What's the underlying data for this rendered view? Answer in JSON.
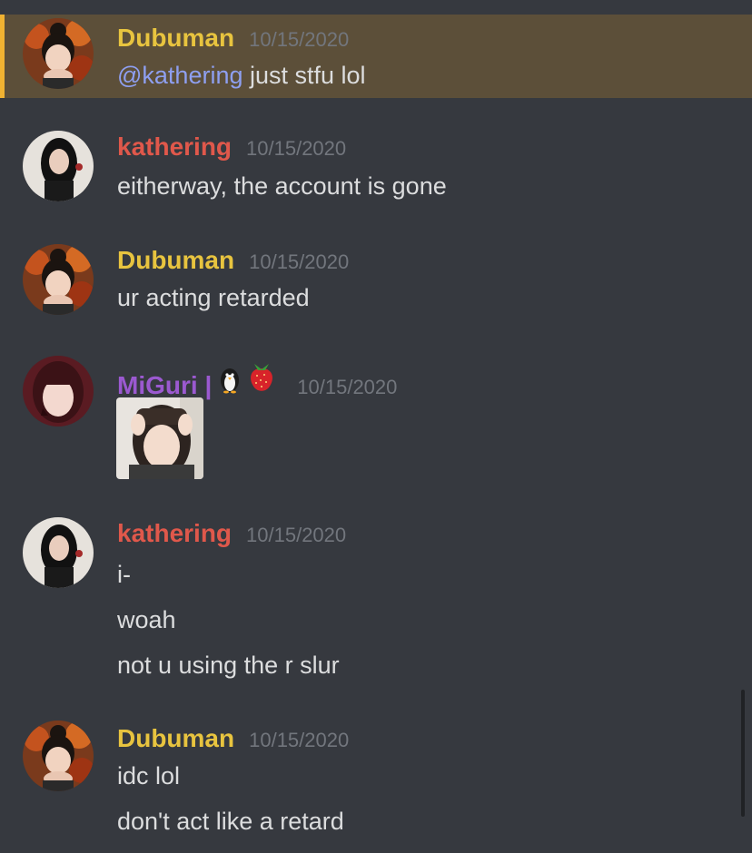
{
  "colors": {
    "background": "#36393f",
    "highlight_bg": "#5c4f39",
    "highlight_bar": "#f0b232",
    "dubuman": "#e8c43f",
    "kathering": "#e0584b",
    "miguri": "#9b59d0",
    "mention": "#8e9ff0",
    "text": "#dcddde",
    "timestamp": "#72767d"
  },
  "messages": [
    {
      "user": "Dubuman",
      "avatar_icon": "dubuman-avatar",
      "time": "10/15/2020",
      "mention": "@kathering",
      "text": " just stfu lol",
      "highlighted": true
    },
    {
      "user": "kathering",
      "avatar_icon": "kathering-avatar",
      "time": "10/15/2020",
      "text": "eitherway, the account is gone"
    },
    {
      "user": "Dubuman",
      "avatar_icon": "dubuman-avatar",
      "time": "10/15/2020",
      "text": "ur acting retarded"
    },
    {
      "user": "MiGuri | ",
      "avatar_icon": "miguri-avatar",
      "name_emojis": [
        "penguin-emoji",
        "strawberry-emoji"
      ],
      "time": "10/15/2020",
      "attachment": "photo-sticker"
    },
    {
      "user": "kathering",
      "avatar_icon": "kathering-avatar",
      "time": "10/15/2020",
      "lines": [
        "i-",
        "woah",
        "not u using the r slur"
      ]
    },
    {
      "user": "Dubuman",
      "avatar_icon": "dubuman-avatar",
      "time": "10/15/2020",
      "lines": [
        "idc lol",
        "don't act like a retard"
      ]
    }
  ]
}
